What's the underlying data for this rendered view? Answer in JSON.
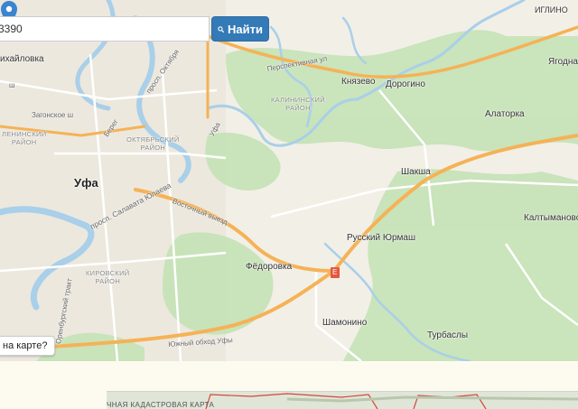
{
  "search": {
    "value": "3390",
    "button_label": "Найти"
  },
  "help": {
    "label": "на карте?"
  },
  "map": {
    "places": {
      "ufa": "Уфа",
      "knyazevo": "Князево",
      "dorogino": "Дорогино",
      "alatorka": "Алаторка",
      "shaksha": "Шакша",
      "kaltymanovo": "Калтыманово",
      "russky_yurmash": "Русский Юрмаш",
      "fedorovka": "Фёдоровка",
      "shamonino": "Шамонино",
      "turbasly": "Турбаслы",
      "yagodnaya": "Ягодна",
      "iglino": "ИГЛИНО",
      "mikhaylovka": "ихайловка"
    },
    "districts": {
      "leninsky": "ЛЕНИНСКИЙ\nРАЙОН",
      "oktyabrsky": "ОКТЯБРЬСКИЙ\nРАЙОН",
      "kalininsky": "КАЛИНИНСКИЙ\nРАЙОН",
      "kirovsky": "КИРОВСКИЙ\nРАЙОН"
    },
    "streets": {
      "zagonskoe": "Загонское ш",
      "oktyabrya": "просп. Октября",
      "perspektivnaya": "Перспективная ул",
      "salavata": "просп. Салавата Юлаева",
      "vostochny": "Восточный выезд",
      "orenburgsky": "Оренбургский тракт",
      "yuzhny": "Южный обход Уфы",
      "ufa_street": "Уфа",
      "bereg": "Берег",
      "sh": "ш"
    },
    "colors": {
      "water": "#a9cfe9",
      "forest": "#c7e3b8",
      "road_major": "#f5b256",
      "road_minor": "#ffffff",
      "pin": "#3a84d0"
    },
    "road_shield": "E"
  },
  "bottom": {
    "caption": "ЧНАЯ КАДАСТРОВАЯ КАРТА"
  }
}
